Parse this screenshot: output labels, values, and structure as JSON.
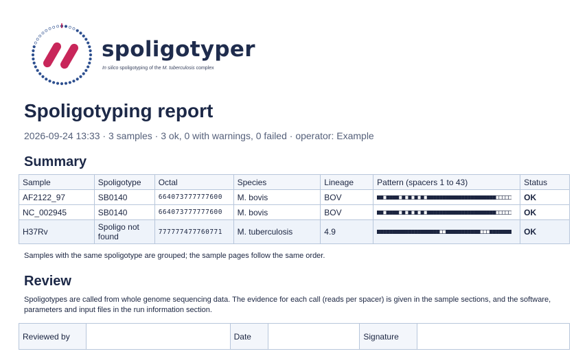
{
  "brand": {
    "name": "spoligotyper",
    "tagline_pre": "In silico",
    "tagline_mid": " spoligotyping of the ",
    "tagline_species": "M. tuberculosis",
    "tagline_post": " complex",
    "colors": {
      "accent": "#c8265a",
      "navy": "#1f2c4d",
      "ring_dot": "#2d4f8f"
    }
  },
  "report": {
    "title": "Spoligotyping report",
    "meta": "2026-09-24 13:33 · 3 samples · 3 ok, 0 with warnings, 0 failed · operator: Example"
  },
  "summary": {
    "heading": "Summary",
    "columns": [
      "Sample",
      "Spoligotype",
      "Octal",
      "Species",
      "Lineage",
      "Pattern (spacers 1 to 43)",
      "Status"
    ],
    "rows": [
      {
        "sample": "AF2122_97",
        "spoligotype": "SB0140",
        "octal": "664073777777600",
        "species": "M. bovis",
        "lineage": "BOV",
        "status": "OK",
        "pattern": "1101111010101010111111111111111111111100000"
      },
      {
        "sample": "NC_002945",
        "spoligotype": "SB0140",
        "octal": "664073777777600",
        "species": "M. bovis",
        "lineage": "BOV",
        "status": "OK",
        "pattern": "1101111010101010111111111111111111111100000"
      },
      {
        "sample": "H37Rv",
        "spoligotype": "Spoligo not found",
        "octal": "777777477760771",
        "species": "M. tuberculosis",
        "lineage": "4.9",
        "status": "OK",
        "pattern": "1111111111111111111100111111111110001111111"
      }
    ],
    "note": "Samples with the same spoligotype are grouped; the sample pages follow the same order."
  },
  "review": {
    "heading": "Review",
    "text": "Spoligotypes are called from whole genome sequencing data. The evidence for each call (reads per spacer) is given in the sample sections, and the software, parameters and input files in the run information section.",
    "fields": {
      "reviewed_by": "Reviewed by",
      "date": "Date",
      "signature": "Signature"
    }
  }
}
